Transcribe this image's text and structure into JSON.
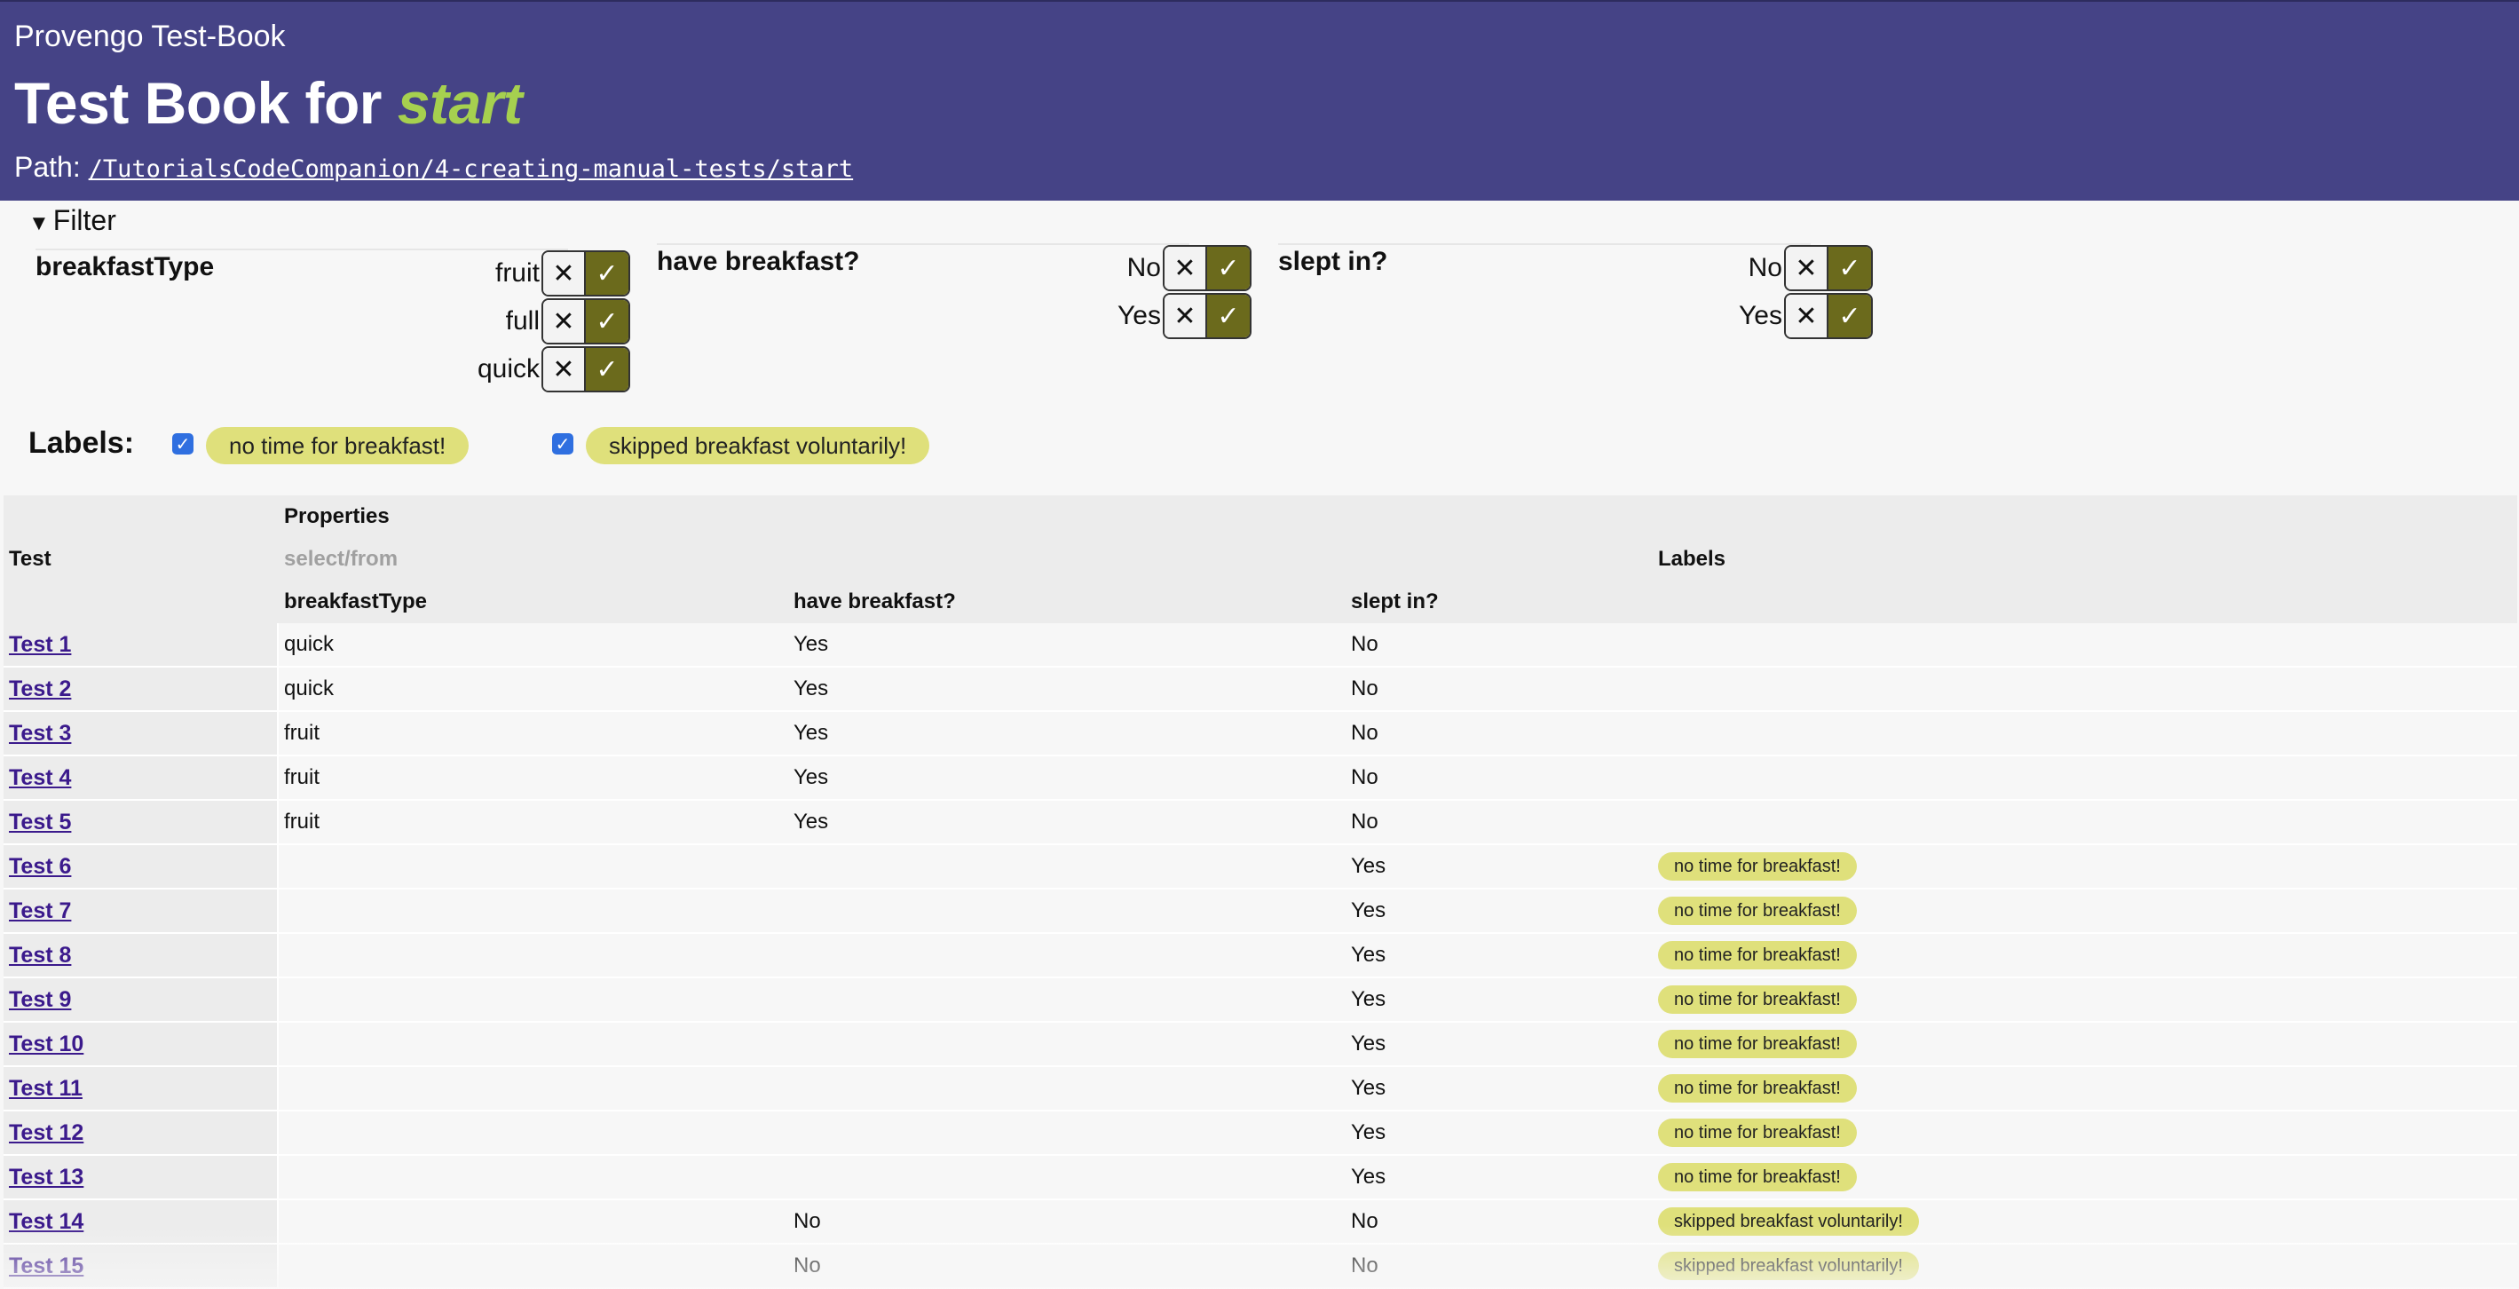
{
  "header": {
    "brand": "Provengo Test-Book",
    "title_prefix": "Test Book for",
    "title_name": "start",
    "path_label": "Path:",
    "path_value": "/TutorialsCodeCompanion/4-creating-manual-tests/start"
  },
  "filter": {
    "toggle_label": "Filter",
    "groups": [
      {
        "title": "breakfastType",
        "options": [
          "fruit",
          "full",
          "quick"
        ]
      },
      {
        "title": "have breakfast?",
        "options": [
          "No",
          "Yes"
        ]
      },
      {
        "title": "slept in?",
        "options": [
          "No",
          "Yes"
        ]
      }
    ],
    "exclude_glyph": "✕",
    "include_glyph": "✓"
  },
  "labels": {
    "title": "Labels:",
    "items": [
      {
        "text": "no time for breakfast!",
        "checked": true
      },
      {
        "text": "skipped breakfast voluntarily!",
        "checked": true
      }
    ]
  },
  "table": {
    "header_test": "Test",
    "header_properties": "Properties",
    "header_select": "select/from",
    "header_labels": "Labels",
    "columns": [
      "breakfastType",
      "have breakfast?",
      "slept in?"
    ],
    "rows": [
      {
        "name": "Test 1",
        "breakfastType": "quick",
        "have": "Yes",
        "slept": "No",
        "label": ""
      },
      {
        "name": "Test 2",
        "breakfastType": "quick",
        "have": "Yes",
        "slept": "No",
        "label": ""
      },
      {
        "name": "Test 3",
        "breakfastType": "fruit",
        "have": "Yes",
        "slept": "No",
        "label": ""
      },
      {
        "name": "Test 4",
        "breakfastType": "fruit",
        "have": "Yes",
        "slept": "No",
        "label": ""
      },
      {
        "name": "Test 5",
        "breakfastType": "fruit",
        "have": "Yes",
        "slept": "No",
        "label": ""
      },
      {
        "name": "Test 6",
        "breakfastType": "",
        "have": "",
        "slept": "Yes",
        "label": "no time for breakfast!"
      },
      {
        "name": "Test 7",
        "breakfastType": "",
        "have": "",
        "slept": "Yes",
        "label": "no time for breakfast!"
      },
      {
        "name": "Test 8",
        "breakfastType": "",
        "have": "",
        "slept": "Yes",
        "label": "no time for breakfast!"
      },
      {
        "name": "Test 9",
        "breakfastType": "",
        "have": "",
        "slept": "Yes",
        "label": "no time for breakfast!"
      },
      {
        "name": "Test 10",
        "breakfastType": "",
        "have": "",
        "slept": "Yes",
        "label": "no time for breakfast!"
      },
      {
        "name": "Test 11",
        "breakfastType": "",
        "have": "",
        "slept": "Yes",
        "label": "no time for breakfast!"
      },
      {
        "name": "Test 12",
        "breakfastType": "",
        "have": "",
        "slept": "Yes",
        "label": "no time for breakfast!"
      },
      {
        "name": "Test 13",
        "breakfastType": "",
        "have": "",
        "slept": "Yes",
        "label": "no time for breakfast!"
      },
      {
        "name": "Test 14",
        "breakfastType": "",
        "have": "No",
        "slept": "No",
        "label": "skipped breakfast voluntarily!"
      },
      {
        "name": "Test 15",
        "breakfastType": "",
        "have": "No",
        "slept": "No",
        "label": "skipped breakfast voluntarily!"
      }
    ]
  },
  "colors": {
    "header_bg": "#454386",
    "title_accent": "#a6d04f",
    "include_bg": "#6b6a1c",
    "label_pill": "#dfe07b",
    "link": "#3b1a8c",
    "checkbox": "#2f6fe0"
  }
}
